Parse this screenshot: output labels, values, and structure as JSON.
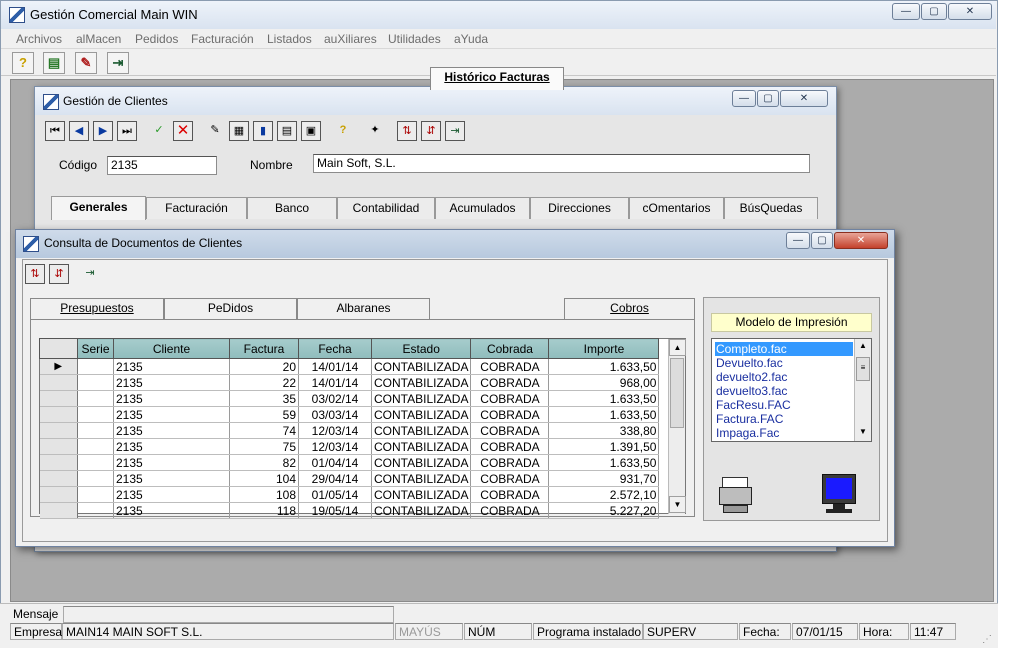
{
  "main": {
    "title": "Gestión Comercial Main WIN",
    "menu": [
      "Archivos",
      "alMacen",
      "Pedidos",
      "Facturación",
      "Listados",
      "auXiliares",
      "Utilidades",
      "aYuda"
    ]
  },
  "clientes": {
    "title": "Gestión de Clientes",
    "codigo_label": "Código",
    "codigo_value": "2135",
    "nombre_label": "Nombre",
    "nombre_value": "Main Soft, S.L.",
    "tabs": [
      "Generales",
      "Facturación",
      "Banco",
      "Contabilidad",
      "Acumulados",
      "Direcciones",
      "cOmentarios",
      "BúsQuedas"
    ]
  },
  "consulta": {
    "title": "Consulta de Documentos de Clientes",
    "tabs": [
      "Presupuestos",
      "PeDidos",
      "Albaranes",
      "Histórico Facturas",
      "Cobros"
    ],
    "columns": [
      "Serie",
      "Cliente",
      "Factura",
      "Fecha",
      "Estado",
      "Cobrada",
      "Importe"
    ],
    "rows": [
      [
        "",
        "2135",
        "20",
        "14/01/14",
        "CONTABILIZADA",
        "COBRADA",
        "1.633,50"
      ],
      [
        "",
        "2135",
        "22",
        "14/01/14",
        "CONTABILIZADA",
        "COBRADA",
        "968,00"
      ],
      [
        "",
        "2135",
        "35",
        "03/02/14",
        "CONTABILIZADA",
        "COBRADA",
        "1.633,50"
      ],
      [
        "",
        "2135",
        "59",
        "03/03/14",
        "CONTABILIZADA",
        "COBRADA",
        "1.633,50"
      ],
      [
        "",
        "2135",
        "74",
        "12/03/14",
        "CONTABILIZADA",
        "COBRADA",
        "338,80"
      ],
      [
        "",
        "2135",
        "75",
        "12/03/14",
        "CONTABILIZADA",
        "COBRADA",
        "1.391,50"
      ],
      [
        "",
        "2135",
        "82",
        "01/04/14",
        "CONTABILIZADA",
        "COBRADA",
        "1.633,50"
      ],
      [
        "",
        "2135",
        "104",
        "29/04/14",
        "CONTABILIZADA",
        "COBRADA",
        "931,70"
      ],
      [
        "",
        "2135",
        "108",
        "01/05/14",
        "CONTABILIZADA",
        "COBRADA",
        "2.572,10"
      ],
      [
        "",
        "2135",
        "118",
        "19/05/14",
        "CONTABILIZADA",
        "COBRADA",
        "5.227,20"
      ]
    ],
    "modelo_label": "Modelo de Impresión",
    "modelos": [
      "Completo.fac",
      "Devuelto.fac",
      "devuelto2.fac",
      "devuelto3.fac",
      "FacResu.FAC",
      "Factura.FAC",
      "Impaga.Fac"
    ]
  },
  "status": {
    "mensaje_label": "Mensaje",
    "empresa_label": "Empresa",
    "empresa_value": "MAIN14  MAIN SOFT  S.L.",
    "mayus": "MAYÚS",
    "num": "NÚM",
    "programa": "Programa instalado",
    "usuario": "SUPERV",
    "fecha_label": "Fecha:",
    "fecha_value": "07/01/15",
    "hora_label": "Hora:",
    "hora_value": "11:47"
  }
}
